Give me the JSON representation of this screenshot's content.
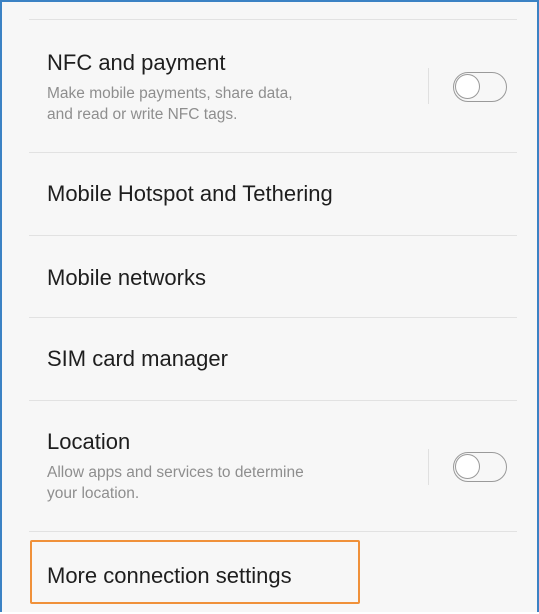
{
  "settings": {
    "items": [
      {
        "title": "NFC and payment",
        "subtitle_line1": "Make mobile payments, share data,",
        "subtitle_line2": "and read or write NFC tags.",
        "toggle_on": false
      },
      {
        "title": "Mobile Hotspot and Tethering"
      },
      {
        "title": "Mobile networks"
      },
      {
        "title": "SIM card manager"
      },
      {
        "title": "Location",
        "subtitle_line1": "Allow apps and services to determine",
        "subtitle_line2": "your location.",
        "toggle_on": false
      },
      {
        "title": "More connection settings",
        "highlighted": true
      }
    ]
  },
  "colors": {
    "background": "#f7f7f7",
    "frame_border": "#3b82c4",
    "highlight_border": "#f0913a",
    "title_text": "#1e1e1e",
    "subtitle_text": "#8e8e8e"
  }
}
